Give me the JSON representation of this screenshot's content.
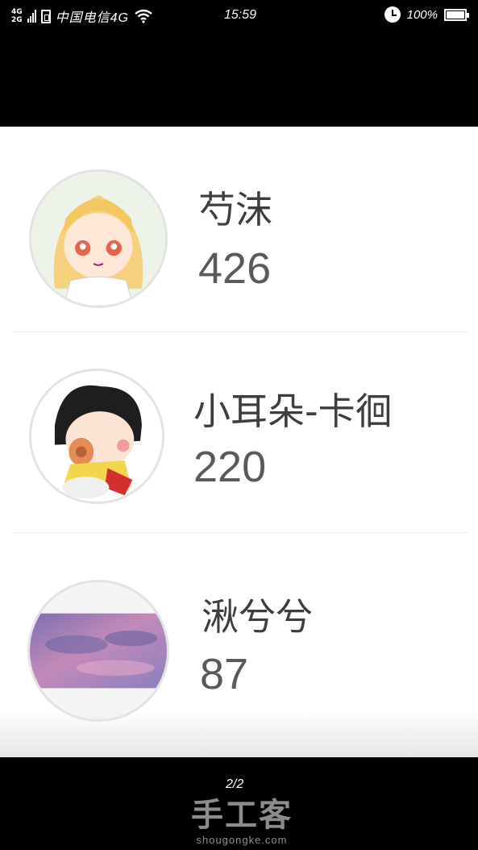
{
  "status_bar": {
    "net_top": "4G",
    "net_bottom": "2G",
    "carrier": "中国电信4G",
    "time": "15:59",
    "battery": "100%"
  },
  "list": [
    {
      "name": "芍沫",
      "count": "426"
    },
    {
      "name": "小耳朵-卡徊",
      "count": "220"
    },
    {
      "name": "湫兮兮",
      "count": "87"
    }
  ],
  "footer": {
    "page": "2/2",
    "watermark": "手工客",
    "watermark_sub": "shougongke.com"
  },
  "colors": {
    "background": "#000000",
    "card": "#ffffff",
    "name_text": "#3e3e3e",
    "count_text": "#5a5a5a"
  }
}
